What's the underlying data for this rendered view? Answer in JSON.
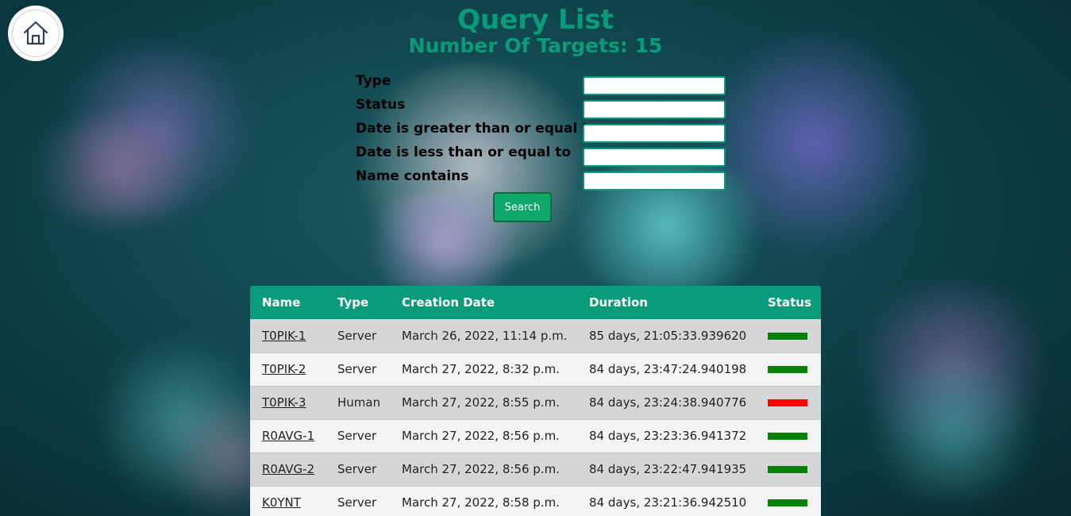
{
  "page": {
    "title": "Query List",
    "subtitle": "Number Of Targets: 15"
  },
  "colors": {
    "accent": "#0a9b7a",
    "button": "#0fa86a",
    "status_ok": "#078007",
    "status_fail": "#ff0000"
  },
  "home_button": {
    "icon": "home-icon"
  },
  "filters": [
    {
      "label": "Type",
      "value": ""
    },
    {
      "label": "Status",
      "value": ""
    },
    {
      "label": "Date is greater than or equal to",
      "value": ""
    },
    {
      "label": "Date is less than or equal to",
      "value": ""
    },
    {
      "label": "Name contains",
      "value": ""
    }
  ],
  "search_button": {
    "label": "Search"
  },
  "table": {
    "headers": [
      "Name",
      "Type",
      "Creation Date",
      "Duration",
      "Status"
    ],
    "rows": [
      {
        "name": "T0PIK-1",
        "type": "Server",
        "creation_date": "March 26, 2022, 11:14 p.m.",
        "duration": "85 days, 21:05:33.939620",
        "status": "ok"
      },
      {
        "name": "T0PIK-2",
        "type": "Server",
        "creation_date": "March 27, 2022, 8:32 p.m.",
        "duration": "84 days, 23:47:24.940198",
        "status": "ok"
      },
      {
        "name": "T0PIK-3",
        "type": "Human",
        "creation_date": "March 27, 2022, 8:55 p.m.",
        "duration": "84 days, 23:24:38.940776",
        "status": "fail"
      },
      {
        "name": "R0AVG-1",
        "type": "Server",
        "creation_date": "March 27, 2022, 8:56 p.m.",
        "duration": "84 days, 23:23:36.941372",
        "status": "ok"
      },
      {
        "name": "R0AVG-2",
        "type": "Server",
        "creation_date": "March 27, 2022, 8:56 p.m.",
        "duration": "84 days, 23:22:47.941935",
        "status": "ok"
      },
      {
        "name": "K0YNT",
        "type": "Server",
        "creation_date": "March 27, 2022, 8:58 p.m.",
        "duration": "84 days, 23:21:36.942510",
        "status": "ok"
      }
    ]
  }
}
